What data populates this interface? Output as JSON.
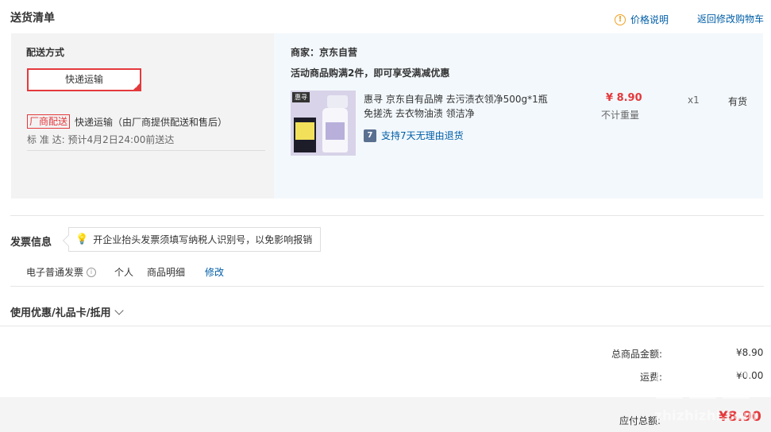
{
  "header": {
    "title": "送货清单",
    "price_note": "价格说明",
    "back_to_cart": "返回修改购物车"
  },
  "shipping": {
    "method_label": "配送方式",
    "method_button": "快递运输",
    "vendor_badge": "厂商配送",
    "vendor_desc": "快递运输（由厂商提供配送和售后）",
    "standard_label": "标 准 达:",
    "standard_value": "预计4月2日24:00前送达"
  },
  "merchant": {
    "label": "商家：京东自营",
    "promo": "活动商品购满2件，即可享受满减优惠"
  },
  "product": {
    "image_badge": "惠寻",
    "name": "惠寻 京东自有品牌 去污渍衣领净500g*1瓶 免搓洗 去衣物油渍 领洁净",
    "return_icon": "7",
    "return_text": "支持7天无理由退货",
    "price": "¥ 8.90",
    "weight": "不计重量",
    "qty": "x1",
    "stock": "有货"
  },
  "invoice": {
    "title": "发票信息",
    "tip": "开企业抬头发票须填写纳税人识别号，以免影响报销",
    "type": "电子普通发票",
    "personal": "个人",
    "detail": "商品明细",
    "edit": "修改"
  },
  "coupon": {
    "title": "使用优惠/礼品卡/抵用"
  },
  "totals": {
    "goods_label": "总商品金额:",
    "goods_value": "¥8.90",
    "freight_label": "运费:",
    "freight_value": "¥0.00",
    "payable_label": "应付总额:",
    "payable_value": "¥8.90"
  },
  "watermark": {
    "text": "zhizhizhi.com"
  },
  "icons": {
    "price_note": "warning-icon",
    "invoice_tip": "lightbulb-icon",
    "invoice_type_info": "info-icon",
    "coupon_toggle": "chevron-down-icon"
  },
  "colors": {
    "accent_red": "#e4393c",
    "link_blue": "#005ea7",
    "warning_orange": "#f0a020"
  }
}
